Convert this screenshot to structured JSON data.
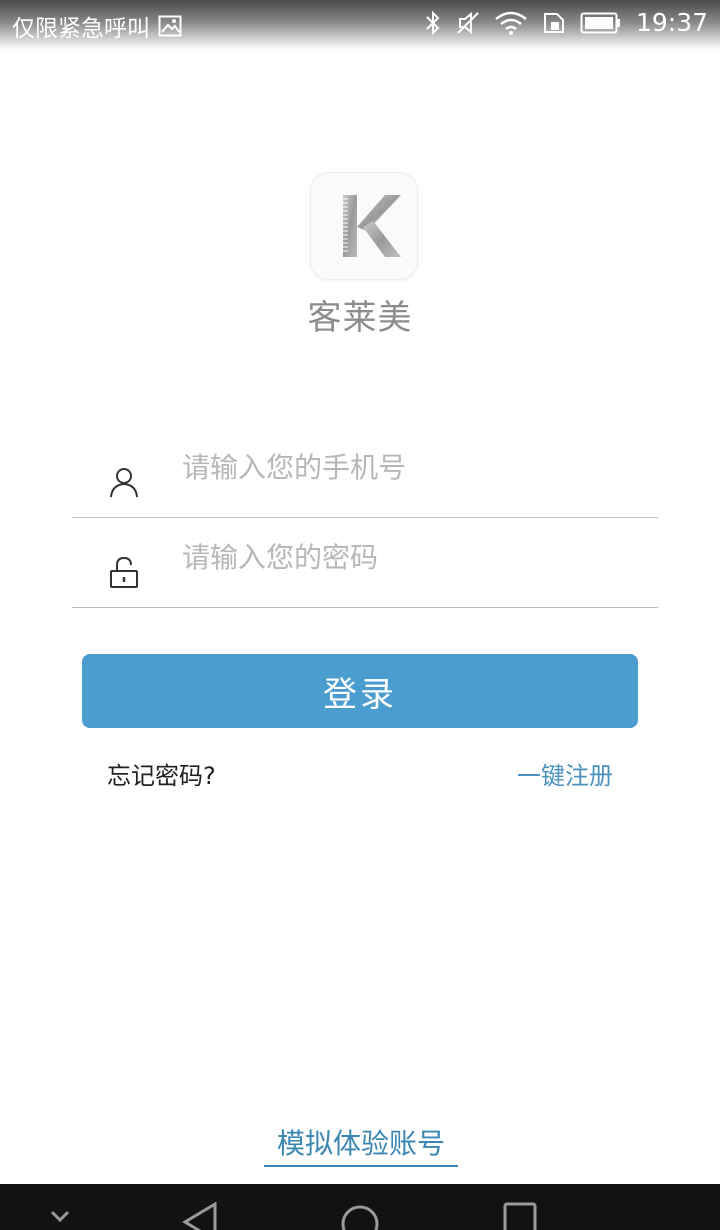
{
  "status_bar": {
    "carrier_text": "仅限紧急呼叫",
    "time": "19:37",
    "icons": [
      "image-icon",
      "bluetooth-icon",
      "mute-icon",
      "wifi-icon",
      "sim-icon",
      "battery-icon"
    ]
  },
  "app": {
    "logo_icon": "k-comb-logo-icon",
    "name": "客莱美"
  },
  "form": {
    "phone": {
      "icon": "user-icon",
      "placeholder": "请输入您的手机号",
      "value": ""
    },
    "password": {
      "icon": "lock-icon",
      "placeholder": "请输入您的密码",
      "value": ""
    },
    "login_label": "登录",
    "forgot_label": "忘记密码?",
    "register_label": "一键注册"
  },
  "demo_link": "模拟体验账号",
  "nav_bar": {
    "icons": [
      "down-icon",
      "back-icon",
      "home-icon",
      "recents-icon"
    ]
  },
  "colors": {
    "accent": "#4b9dd0",
    "link": "#4a93bf",
    "placeholder": "#b7b7b7"
  }
}
